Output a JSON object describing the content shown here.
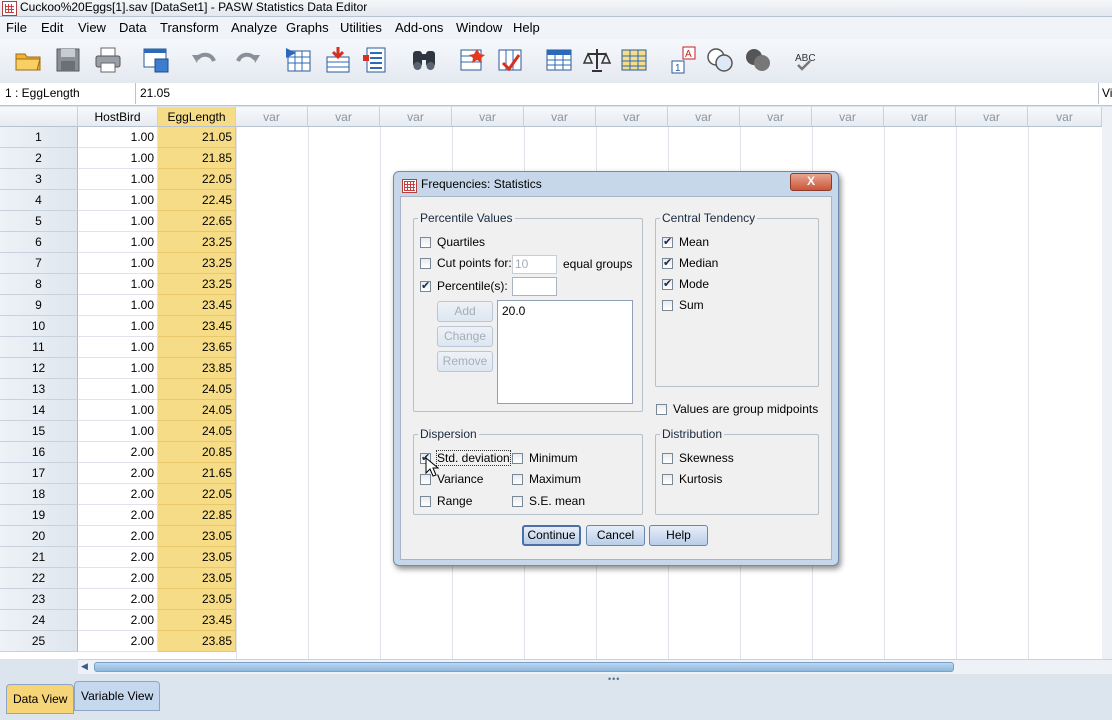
{
  "window": {
    "title": "Cuckoo%20Eggs[1].sav [DataSet1] - PASW Statistics Data Editor"
  },
  "menu": [
    "File",
    "Edit",
    "View",
    "Data",
    "Transform",
    "Analyze",
    "Graphs",
    "Utilities",
    "Add-ons",
    "Window",
    "Help"
  ],
  "toolbar": [
    "open-icon",
    "save-icon",
    "print-icon",
    "recall-dialog-icon",
    "undo-icon",
    "redo-icon",
    "goto-case-icon",
    "goto-variable-icon",
    "variables-icon",
    "find-icon",
    "insert-cases-icon",
    "insert-variable-icon",
    "split-file-icon",
    "weight-cases-icon",
    "select-cases-icon",
    "value-labels-icon",
    "use-sets-icon",
    "show-all-variables-icon",
    "spell-check-icon"
  ],
  "cell_editor": {
    "ref": "1 : EggLength",
    "value": "21.05",
    "right": "Vi"
  },
  "grid": {
    "columns": [
      "HostBird",
      "EggLength",
      "var",
      "var",
      "var",
      "var",
      "var",
      "var",
      "var",
      "var",
      "var",
      "var",
      "var",
      "var"
    ],
    "rows": [
      [
        "1",
        "1.00",
        "21.05"
      ],
      [
        "2",
        "1.00",
        "21.85"
      ],
      [
        "3",
        "1.00",
        "22.05"
      ],
      [
        "4",
        "1.00",
        "22.45"
      ],
      [
        "5",
        "1.00",
        "22.65"
      ],
      [
        "6",
        "1.00",
        "23.25"
      ],
      [
        "7",
        "1.00",
        "23.25"
      ],
      [
        "8",
        "1.00",
        "23.25"
      ],
      [
        "9",
        "1.00",
        "23.45"
      ],
      [
        "10",
        "1.00",
        "23.45"
      ],
      [
        "11",
        "1.00",
        "23.65"
      ],
      [
        "12",
        "1.00",
        "23.85"
      ],
      [
        "13",
        "1.00",
        "24.05"
      ],
      [
        "14",
        "1.00",
        "24.05"
      ],
      [
        "15",
        "1.00",
        "24.05"
      ],
      [
        "16",
        "2.00",
        "20.85"
      ],
      [
        "17",
        "2.00",
        "21.65"
      ],
      [
        "18",
        "2.00",
        "22.05"
      ],
      [
        "19",
        "2.00",
        "22.85"
      ],
      [
        "20",
        "2.00",
        "23.05"
      ],
      [
        "21",
        "2.00",
        "23.05"
      ],
      [
        "22",
        "2.00",
        "23.05"
      ],
      [
        "23",
        "2.00",
        "23.05"
      ],
      [
        "24",
        "2.00",
        "23.45"
      ],
      [
        "25",
        "2.00",
        "23.85"
      ]
    ]
  },
  "tabs": {
    "data_view": "Data View",
    "variable_view": "Variable View"
  },
  "dialog": {
    "title": "Frequencies: Statistics",
    "close": "X",
    "percentile": {
      "legend": "Percentile Values",
      "quartiles": "Quartiles",
      "cut_points": "Cut points for:",
      "cut_value": "10",
      "equal_groups": "equal groups",
      "percentiles": "Percentile(s):",
      "percentile_input": "",
      "add": "Add",
      "change": "Change",
      "remove": "Remove",
      "list": [
        "20.0"
      ]
    },
    "central": {
      "legend": "Central Tendency",
      "mean": "Mean",
      "median": "Median",
      "mode": "Mode",
      "sum": "Sum"
    },
    "midpoints": "Values are group midpoints",
    "dispersion": {
      "legend": "Dispersion",
      "std": "Std. deviation",
      "minimum": "Minimum",
      "variance": "Variance",
      "maximum": "Maximum",
      "range": "Range",
      "se_mean": "S.E. mean"
    },
    "distribution": {
      "legend": "Distribution",
      "skewness": "Skewness",
      "kurtosis": "Kurtosis"
    },
    "buttons": {
      "continue": "Continue",
      "cancel": "Cancel",
      "help": "Help"
    }
  }
}
